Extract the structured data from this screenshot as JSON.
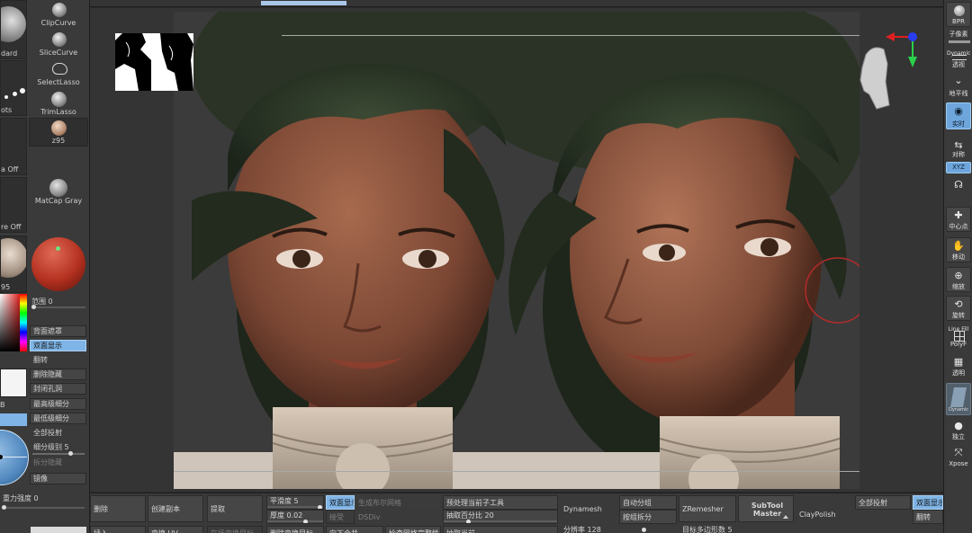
{
  "left_panel": {
    "brushes": {
      "standard_caption": "dard",
      "clipcurve": "ClipCurve",
      "slicecurve": "SliceCurve",
      "selectlasso": "SelectLasso",
      "trimlasso": "TrimLasso",
      "dots_caption": "ots",
      "z95": "z95",
      "alpha_caption": "a Off",
      "matcap": "MatCap Gray",
      "texture_caption": "re Off",
      "material_caption": "95"
    },
    "range_label": "范围 0",
    "ops": [
      {
        "label": "背面遮罩",
        "state": "normal"
      },
      {
        "label": "双面显示",
        "state": "active"
      },
      {
        "label": "翻转",
        "state": "normal"
      },
      {
        "label": "删除隐藏",
        "state": "normal"
      },
      {
        "label": "封闭孔洞",
        "state": "normal"
      },
      {
        "label": "最高级细分",
        "state": "normal"
      },
      {
        "label": "最低级细分",
        "state": "normal"
      },
      {
        "label": "全部投射",
        "state": "normal"
      },
      {
        "label": "细分级别 5",
        "state": "slider"
      },
      {
        "label": "拆分隐藏",
        "state": "dim"
      },
      {
        "label": "镜像",
        "state": "normal"
      }
    ],
    "side_caption_b": "B",
    "gravity_label": "重力强度 0"
  },
  "right_shelf": [
    {
      "icon": "BPR",
      "label": "BPR",
      "state": "normal"
    },
    {
      "icon": "▭",
      "label": "子像素",
      "state": "normal"
    },
    {
      "icon": "Dynamic",
      "label": "透视",
      "state": "normal"
    },
    {
      "icon": "⌄",
      "label": "地平线",
      "state": "normal"
    },
    {
      "icon": "◉",
      "label": "实时",
      "state": "active"
    },
    {
      "icon": "⇆",
      "label": "对称",
      "state": "normal"
    },
    {
      "icon": "XYZ",
      "label": "",
      "state": "active-small"
    },
    {
      "icon": "☊",
      "label": "",
      "state": "normal"
    },
    {
      "icon": "✚",
      "label": "中心点",
      "state": "normal"
    },
    {
      "icon": "✋",
      "label": "移动",
      "state": "normal"
    },
    {
      "icon": "⊕",
      "label": "缩放",
      "state": "normal"
    },
    {
      "icon": "⟲",
      "label": "旋转",
      "state": "normal"
    },
    {
      "icon": "Line Fill",
      "label": "PolyF",
      "state": "normal"
    },
    {
      "icon": "▦",
      "label": "透明",
      "state": "normal"
    },
    {
      "icon": "Dynamic",
      "label": "",
      "state": "dim"
    },
    {
      "icon": "●",
      "label": "独立",
      "state": "normal"
    },
    {
      "icon": "⤧",
      "label": "Xpose",
      "state": "normal"
    }
  ],
  "bottom": {
    "row1": {
      "delete": "删除",
      "duplicate": "创建副本",
      "extract": "提取",
      "smooth": "平滑度 5",
      "double": "双面显示",
      "gen_mesh": "生成布尔网格",
      "preprocess": "预处理当前子工具",
      "dynamesh": "Dynamesh",
      "autogroup": "自动分组",
      "zremesher": "ZRemesher",
      "subtool_master": "SubTool Master",
      "claypolish": "ClayPolish",
      "project_all": "全部投射",
      "double2": "双面显示"
    },
    "row2": {
      "thickness": "厚度 0.02",
      "accept": "接受",
      "dsdiv": "DSDiv",
      "extract_pct": "抽取百分比 20",
      "split_group": "按组拆分",
      "flip": "翻转"
    },
    "row3": {
      "insert": "插入",
      "uv": "变换 UV",
      "del_target": "在场变换目标",
      "del_target2": "删除变换目标",
      "merge_down": "向下合并",
      "check_mesh": "检查网格完整性",
      "decimate": "抽取当前",
      "resolution": "分辨率 128",
      "target_poly": "目标多边形数 5"
    }
  },
  "colors": {
    "accent": "#7fb4e6",
    "panel": "#3a3a3a",
    "canvas": "#343434"
  }
}
